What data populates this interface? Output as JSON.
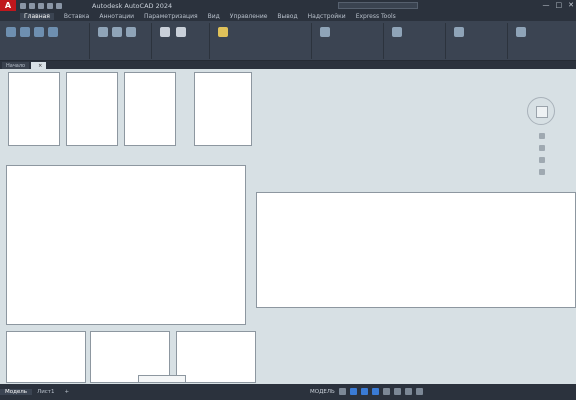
{
  "app": {
    "logo": "A",
    "title": "Autodesk AutoCAD 2024",
    "user": "",
    "window_controls": [
      "—",
      "□",
      "✕"
    ]
  },
  "ribbon_tabs": [
    {
      "label": "Главная",
      "active": true
    },
    {
      "label": "Вставка"
    },
    {
      "label": "Аннотации"
    },
    {
      "label": "Параметризация"
    },
    {
      "label": "Вид"
    },
    {
      "label": "Управление"
    },
    {
      "label": "Вывод"
    },
    {
      "label": "Надстройки"
    },
    {
      "label": "Express Tools"
    }
  ],
  "file_tabs": [
    {
      "label": "Начало"
    },
    {
      "label": "",
      "active": true
    }
  ],
  "layout_tabs": [
    {
      "label": "Модель",
      "active": true
    },
    {
      "label": "Лист1"
    },
    {
      "label": "+"
    }
  ],
  "status": {
    "workspace": "МОДЕЛЬ"
  },
  "colors": {
    "titlebar": "#2b323d",
    "ribbon": "#3b4452",
    "canvas": "#d7e0e4",
    "accent": "#c0171d"
  }
}
